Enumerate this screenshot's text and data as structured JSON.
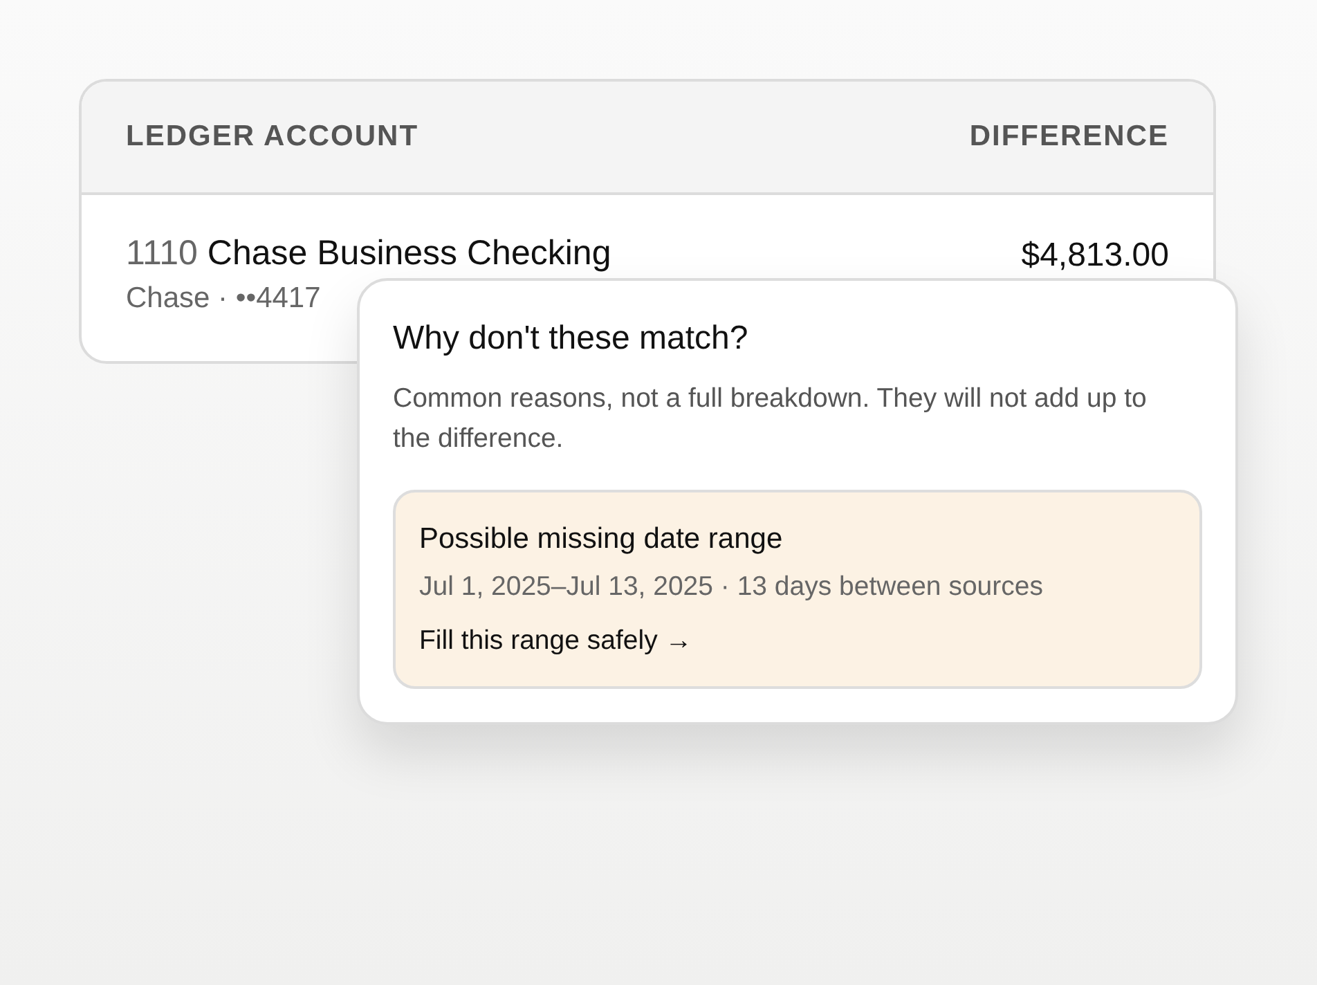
{
  "table": {
    "columns": [
      "LEDGER ACCOUNT",
      "DIFFERENCE"
    ],
    "rows": [
      {
        "number": "1110",
        "name": "Chase Business Checking",
        "subtitle": "Chase · ••4417",
        "difference": "$4,813.00"
      }
    ]
  },
  "popover": {
    "title": "Why don't these match?",
    "description": "Common reasons, not a full breakdown. They will not add up to the difference.",
    "reasons": [
      {
        "title": "Possible missing date range",
        "detail": "Jul 1, 2025–Jul 13, 2025 · 13 days between sources",
        "action": "Fill this range safely →"
      }
    ]
  }
}
